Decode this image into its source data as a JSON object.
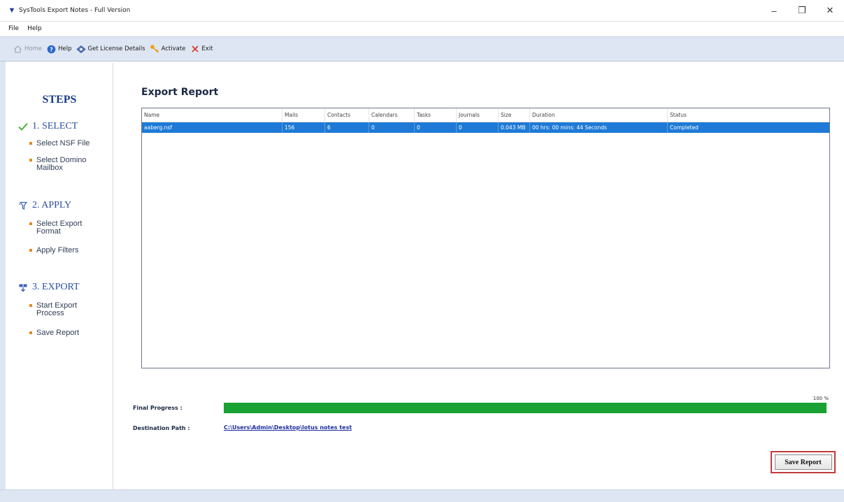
{
  "window": {
    "title": "SysTools Export Notes - Full Version",
    "controls": {
      "minimize": "–",
      "maximize": "❐",
      "close": "✕"
    }
  },
  "menu": {
    "items": [
      "File",
      "Help"
    ]
  },
  "toolbar": {
    "items": [
      {
        "label": "Home",
        "icon": "home-icon",
        "enabled": false
      },
      {
        "label": "Help",
        "icon": "help-icon",
        "enabled": true
      },
      {
        "label": "Get License Details",
        "icon": "license-icon",
        "enabled": true
      },
      {
        "label": "Activate",
        "icon": "key-icon",
        "enabled": true
      },
      {
        "label": "Exit",
        "icon": "exit-icon",
        "enabled": true
      }
    ]
  },
  "sidebar": {
    "title": "STEPS",
    "steps": [
      {
        "label": "1. SELECT",
        "icon": "check-icon",
        "subitems": [
          "Select NSF File",
          "Select Domino Mailbox"
        ]
      },
      {
        "label": "2. APPLY",
        "icon": "filter-icon",
        "subitems": [
          "Select Export Format",
          "Apply Filters"
        ]
      },
      {
        "label": "3. EXPORT",
        "icon": "export-icon",
        "subitems": [
          "Start Export Process",
          "Save Report"
        ]
      }
    ]
  },
  "main": {
    "title": "Export Report",
    "table": {
      "columns": [
        "Name",
        "Mails",
        "Contacts",
        "Calendars",
        "Tasks",
        "Journals",
        "Size",
        "Duration",
        "Status"
      ],
      "rows": [
        {
          "name": "aaberg.nsf",
          "mails": "156",
          "contacts": "6",
          "calendars": "0",
          "tasks": "0",
          "journals": "0",
          "size": "0.043 MB",
          "duration": "00 hrs: 00 mins: 44 Seconds",
          "status": "Completed"
        }
      ]
    },
    "progress": {
      "label": "Final Progress :",
      "percent_text": "100 %",
      "value": 1.0
    },
    "destination": {
      "label": "Destination Path :",
      "path": "C:\\Users\\Admin\\Desktop\\lotus notes test"
    },
    "save_report_label": "Save Report"
  },
  "colors": {
    "accent": "#1e7ad6",
    "progress": "#17a233",
    "steps_title": "#183a8a",
    "toolbar_bg": "#dfe6f3",
    "save_highlight": "#c23b3b"
  }
}
